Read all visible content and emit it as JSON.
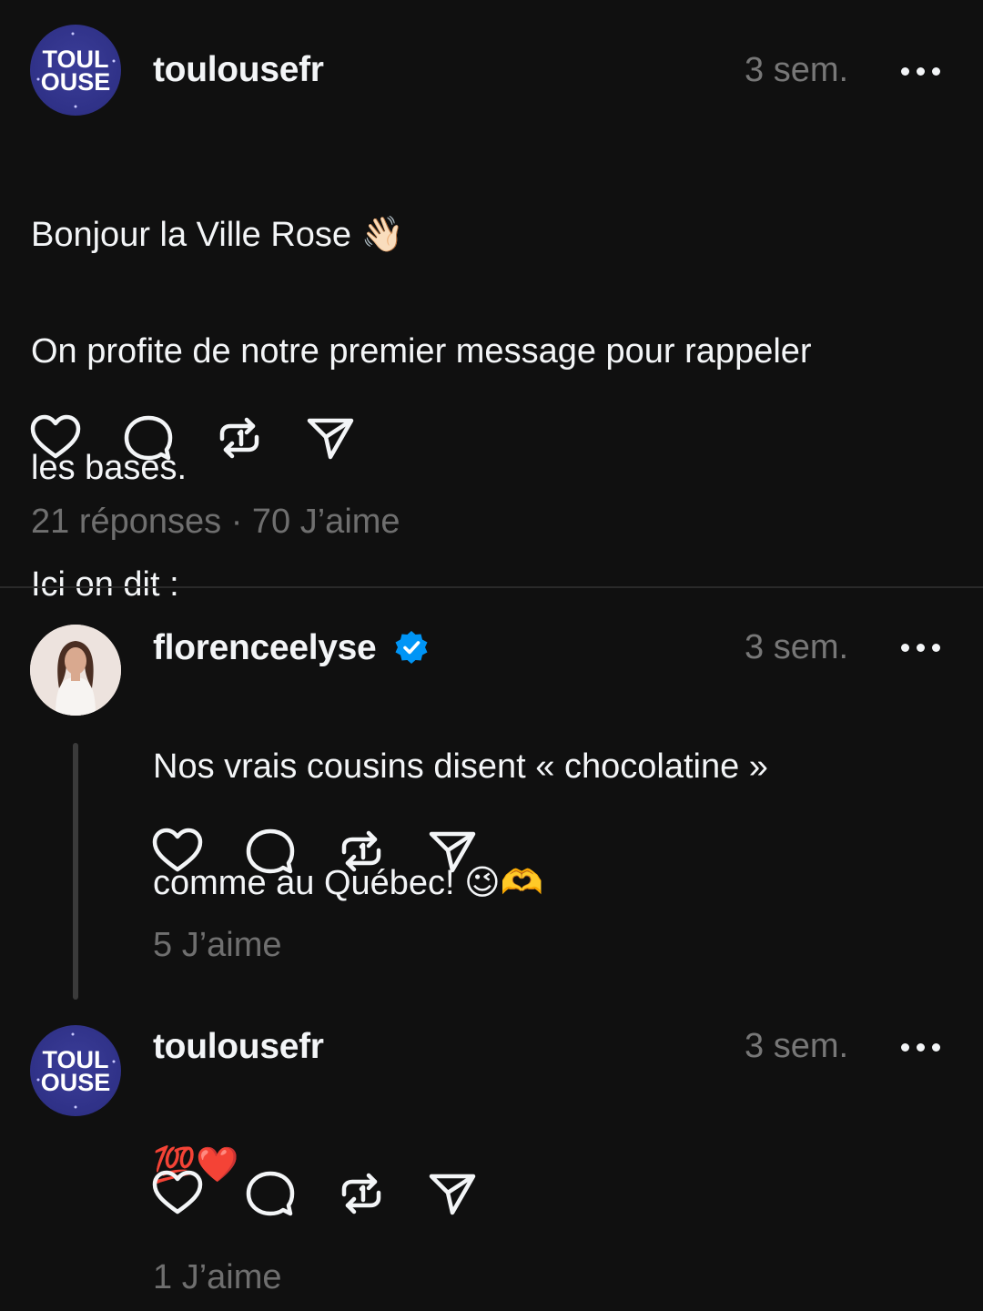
{
  "posts": [
    {
      "username": "toulousefr",
      "time": "3 sem.",
      "avatar_text": [
        "TOUL",
        "OUSE"
      ],
      "lines": [
        "Bonjour la Ville Rose 👋🏻",
        "On profite de notre premier message pour rappeler",
        "les bases.",
        "Ici on dit :"
      ],
      "stats": "21 réponses · 70 J’aime"
    },
    {
      "username": "florenceelyse",
      "verified": true,
      "time": "3 sem.",
      "lines": [
        "Nos vrais cousins disent « chocolatine »",
        "comme au Québec! 😉🫶"
      ],
      "stats": "5 J’aime"
    },
    {
      "username": "toulousefr",
      "time": "3 sem.",
      "avatar_text": [
        "TOUL",
        "OUSE"
      ],
      "lines": [
        "💯❤️"
      ],
      "stats": "1 J’aime"
    }
  ],
  "icons": [
    "heart-icon",
    "comment-icon",
    "repost-icon",
    "share-icon",
    "more-icon",
    "verified-badge-icon"
  ],
  "colors": {
    "background": "#101010",
    "text": "#f3f5f7",
    "muted": "#777777",
    "verified": "#0095f6",
    "toulouse_avatar": "#2f3187"
  }
}
